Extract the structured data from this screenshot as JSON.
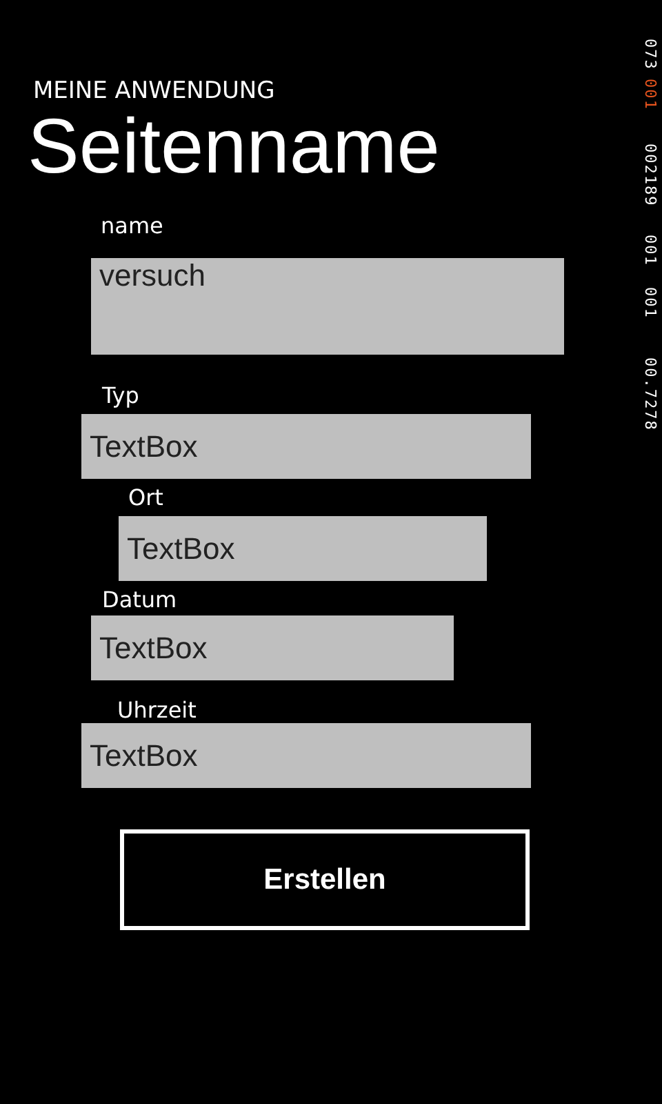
{
  "app_title": "MEINE ANWENDUNG",
  "page_title": "Seitenname",
  "fields": [
    {
      "label": "name",
      "value": "versuch",
      "kind": "tall"
    },
    {
      "label": "Typ",
      "value": "TextBox",
      "kind": "short"
    },
    {
      "label": "Ort",
      "value": "TextBox",
      "kind": "short"
    },
    {
      "label": "Datum",
      "value": "TextBox",
      "kind": "short"
    },
    {
      "label": "Uhrzeit",
      "value": "TextBox",
      "kind": "short"
    }
  ],
  "button": "Erstellen",
  "counters": [
    {
      "value": "073",
      "color": "#ffffff"
    },
    {
      "value": "001",
      "color": "#e8541e"
    },
    {
      "value": "002189",
      "color": "#ffffff"
    },
    {
      "value": "001",
      "color": "#ffffff"
    },
    {
      "value": "001",
      "color": "#ffffff"
    },
    {
      "value": "00.7278",
      "color": "#ffffff"
    }
  ]
}
